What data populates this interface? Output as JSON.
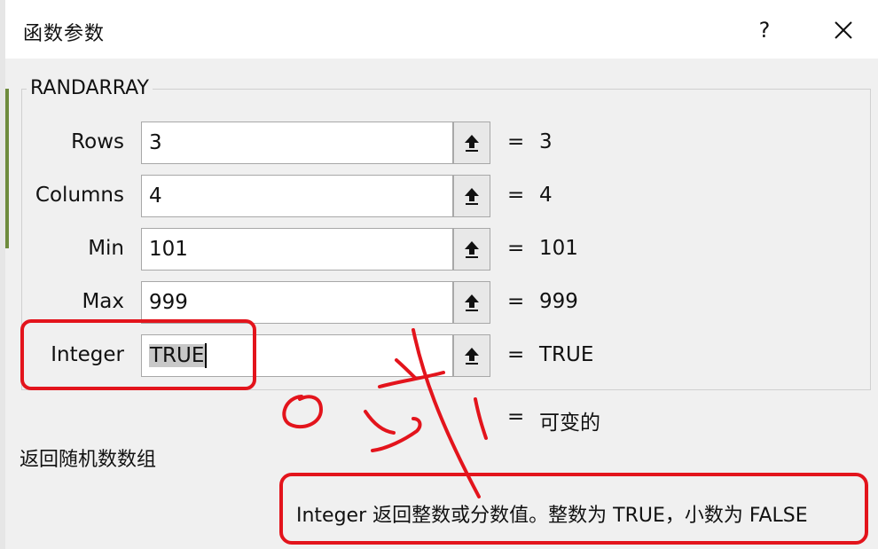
{
  "dialog": {
    "title": "函数参数",
    "help_label": "?",
    "close_icon": "close-icon"
  },
  "function": {
    "name": "RANDARRAY",
    "args": [
      {
        "label": "Rows",
        "value": "3",
        "result": "3"
      },
      {
        "label": "Columns",
        "value": "4",
        "result": "4"
      },
      {
        "label": "Min",
        "value": "101",
        "result": "101"
      },
      {
        "label": "Max",
        "value": "999",
        "result": "999"
      },
      {
        "label": "Integer",
        "value": "TRUE",
        "result": "TRUE"
      }
    ],
    "equals": "=",
    "overall_result": "可变的",
    "description": "返回随机数数组",
    "arg_help": "Integer   返回整数或分数值。整数为 TRUE，小数为 FALSE"
  },
  "icons": {
    "collapse": "collapse-arrow-icon"
  },
  "annotation_colors": {
    "red": "#e3141c"
  }
}
